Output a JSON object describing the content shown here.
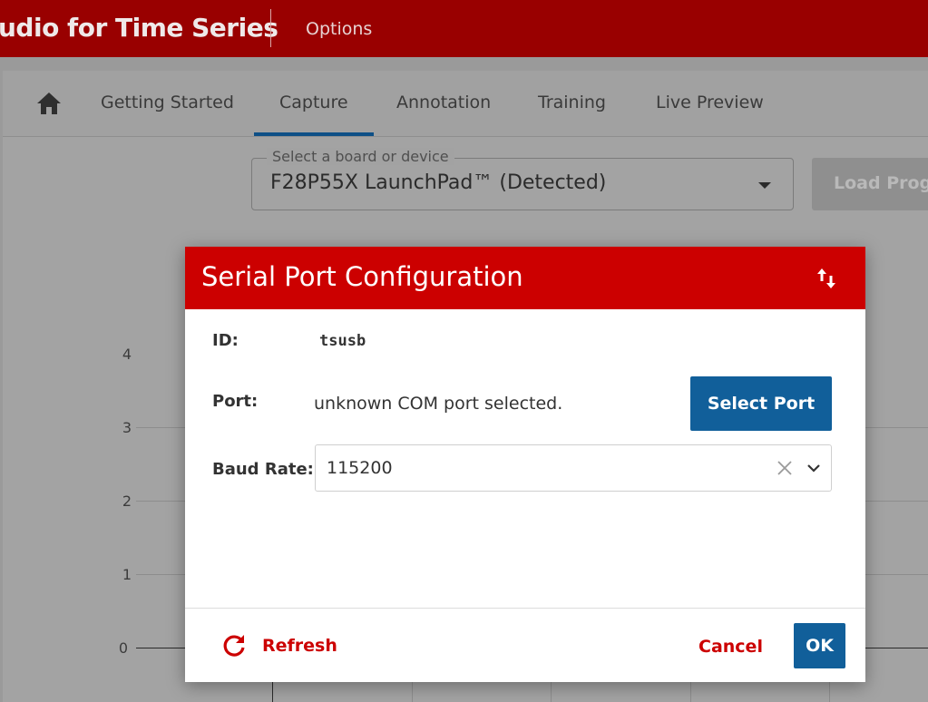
{
  "app": {
    "title": "udio for Time Series",
    "options_label": "Options"
  },
  "tabs": [
    {
      "label": "Getting Started"
    },
    {
      "label": "Capture",
      "active": true
    },
    {
      "label": "Annotation"
    },
    {
      "label": "Training"
    },
    {
      "label": "Live Preview"
    }
  ],
  "board_select": {
    "label": "Select a board or device",
    "value": "F28P55X LaunchPad™ (Detected)"
  },
  "load_button": {
    "label": "Load Progr"
  },
  "chart_bg": {
    "yticks": [
      "4",
      "3",
      "2",
      "1",
      "0"
    ]
  },
  "dialog": {
    "title": "Serial Port Configuration",
    "id_label": "ID:",
    "id_value": "tsusb",
    "port_label": "Port:",
    "port_value": "unknown COM port selected.",
    "select_port_label": "Select Port",
    "baud_label": "Baud Rate:",
    "baud_value": "115200",
    "refresh_label": "Refresh",
    "cancel_label": "Cancel",
    "ok_label": "OK"
  },
  "colors": {
    "brand_red": "#cc0000",
    "primary_blue": "#115f9a"
  }
}
